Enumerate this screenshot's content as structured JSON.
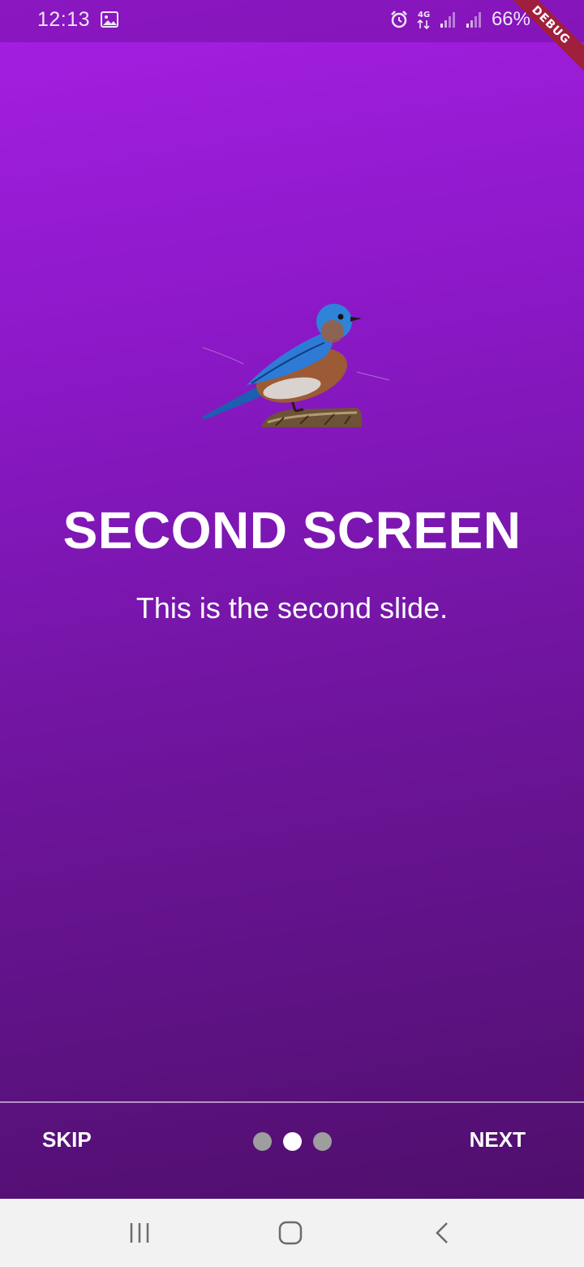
{
  "status_bar": {
    "time": "12:13",
    "battery": "66%",
    "network": "4G",
    "icons": [
      "image-icon",
      "alarm-icon",
      "network-4g-icon",
      "signal-icon",
      "signal-icon",
      "battery-icon"
    ]
  },
  "debug_banner": "DEBUG",
  "slide": {
    "image": "bluebird-illustration",
    "title": "SECOND SCREEN",
    "description": "This is the second slide."
  },
  "footer": {
    "skip_label": "SKIP",
    "next_label": "NEXT",
    "page_count": 3,
    "current_page": 2
  },
  "nav_bar": {
    "icons": [
      "recent-apps-icon",
      "home-icon",
      "back-icon"
    ]
  },
  "colors": {
    "gradient_top": "#a61fe3",
    "gradient_bottom": "#4f0f6c",
    "dot_active": "#ffffff",
    "dot_inactive": "#9e9e9e",
    "debug_ribbon": "#a01f3c"
  }
}
